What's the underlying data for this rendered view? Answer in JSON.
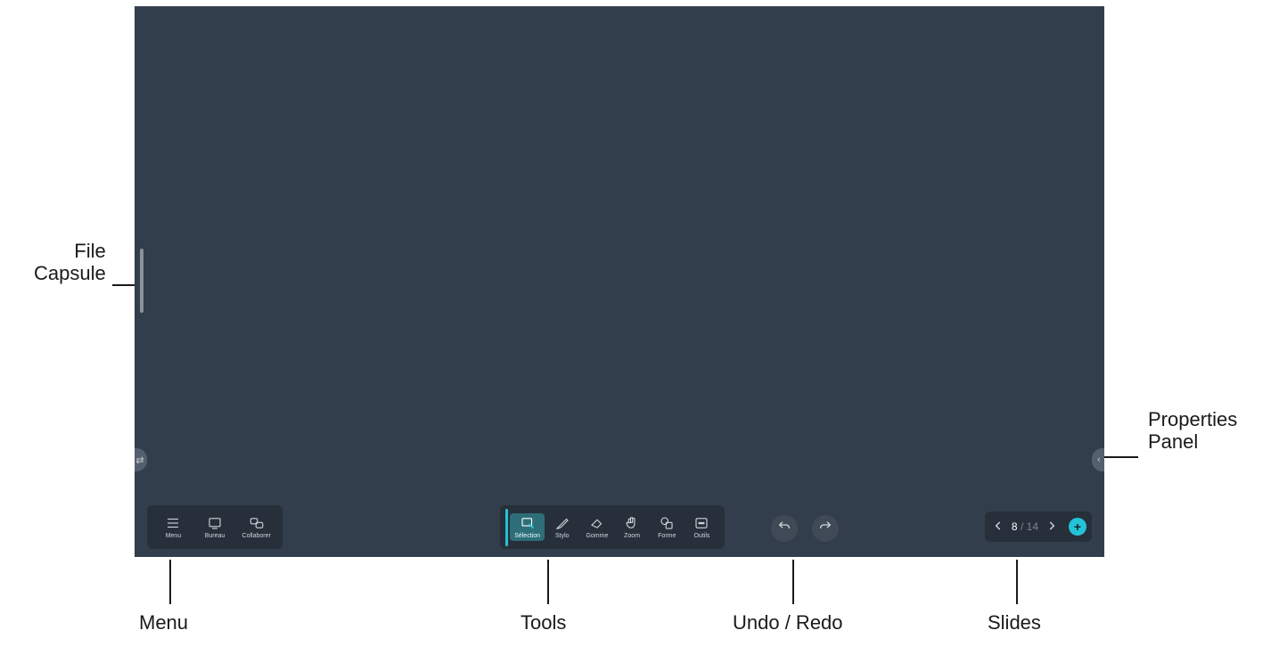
{
  "annotations": {
    "file_capsule": "File\nCapsule",
    "properties_panel": "Properties\nPanel",
    "menu": "Menu",
    "tools": "Tools",
    "undo_redo": "Undo / Redo",
    "slides": "Slides"
  },
  "menu_bar": {
    "items": [
      {
        "label": "Menu",
        "icon": "menu"
      },
      {
        "label": "Bureau",
        "icon": "desktop"
      },
      {
        "label": "Collaborer",
        "icon": "collab"
      }
    ]
  },
  "tool_bar": {
    "items": [
      {
        "label": "Sélection",
        "icon": "selection",
        "active": true
      },
      {
        "label": "Stylo",
        "icon": "pen",
        "active": false
      },
      {
        "label": "Gomme",
        "icon": "eraser",
        "active": false
      },
      {
        "label": "Zoom",
        "icon": "zoom",
        "active": false
      },
      {
        "label": "Forme",
        "icon": "shape",
        "active": false
      },
      {
        "label": "Outils",
        "icon": "more",
        "active": false
      }
    ]
  },
  "undo_redo": {
    "undo": "undo",
    "redo": "redo"
  },
  "slides": {
    "current": "8",
    "separator": "/",
    "total": "14",
    "add_label": "+"
  },
  "left_tab_glyph": "⇄",
  "right_tab_glyph": "‹"
}
